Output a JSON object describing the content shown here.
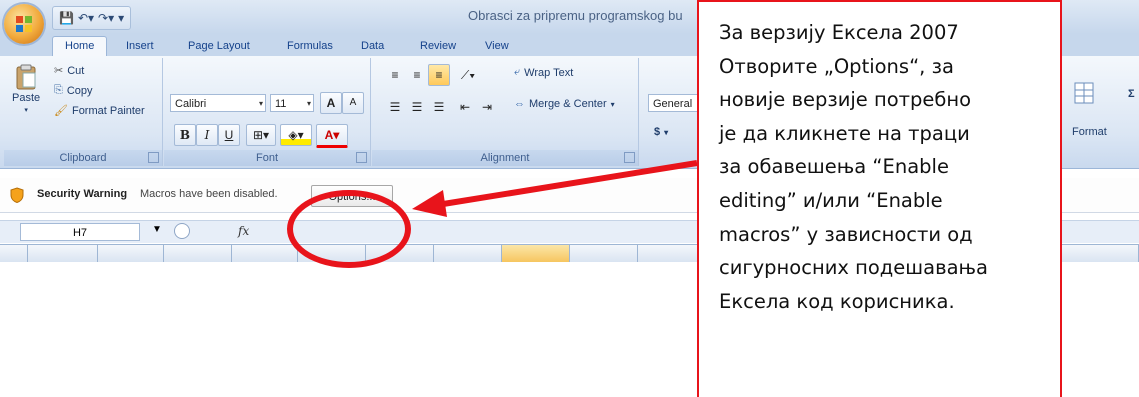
{
  "window": {
    "title": "Obrasci za pripremu programskog bu"
  },
  "tabs": [
    "Home",
    "Insert",
    "Page Layout",
    "Formulas",
    "Data",
    "Review",
    "View"
  ],
  "clipboard": {
    "paste": "Paste",
    "cut": "Cut",
    "copy": "Copy",
    "format_painter": "Format Painter",
    "label": "Clipboard"
  },
  "font": {
    "name": "Calibri",
    "size": "11",
    "bold": "B",
    "italic": "I",
    "underline": "U",
    "grow": "A",
    "shrink": "A",
    "label": "Font"
  },
  "alignment": {
    "wrap_text": "Wrap Text",
    "merge_center": "Merge & Center",
    "label": "Alignment"
  },
  "number": {
    "format": "General",
    "currency": "$"
  },
  "cells": {
    "format": "Format",
    "sigma": "Σ"
  },
  "security": {
    "title": "Security Warning",
    "message": "Macros have been disabled.",
    "options_label": "Options..."
  },
  "formula_bar": {
    "name_box": "H7",
    "fx": "fx"
  },
  "callout": {
    "lines": [
      "За верзију Ексела 2007",
      "Отворите „Options“, за",
      "новије верзије потребно",
      "је  да кликнете на траци",
      "за обавешења  “Enable",
      "editing” и/или “Enable",
      "macros” у зависности од",
      "сигурносних подешавања",
      "Ексела код корисника."
    ]
  },
  "colors": {
    "accent": "#e8141b",
    "ribbon": "#dbe6f4",
    "tab_text": "#15428b"
  }
}
